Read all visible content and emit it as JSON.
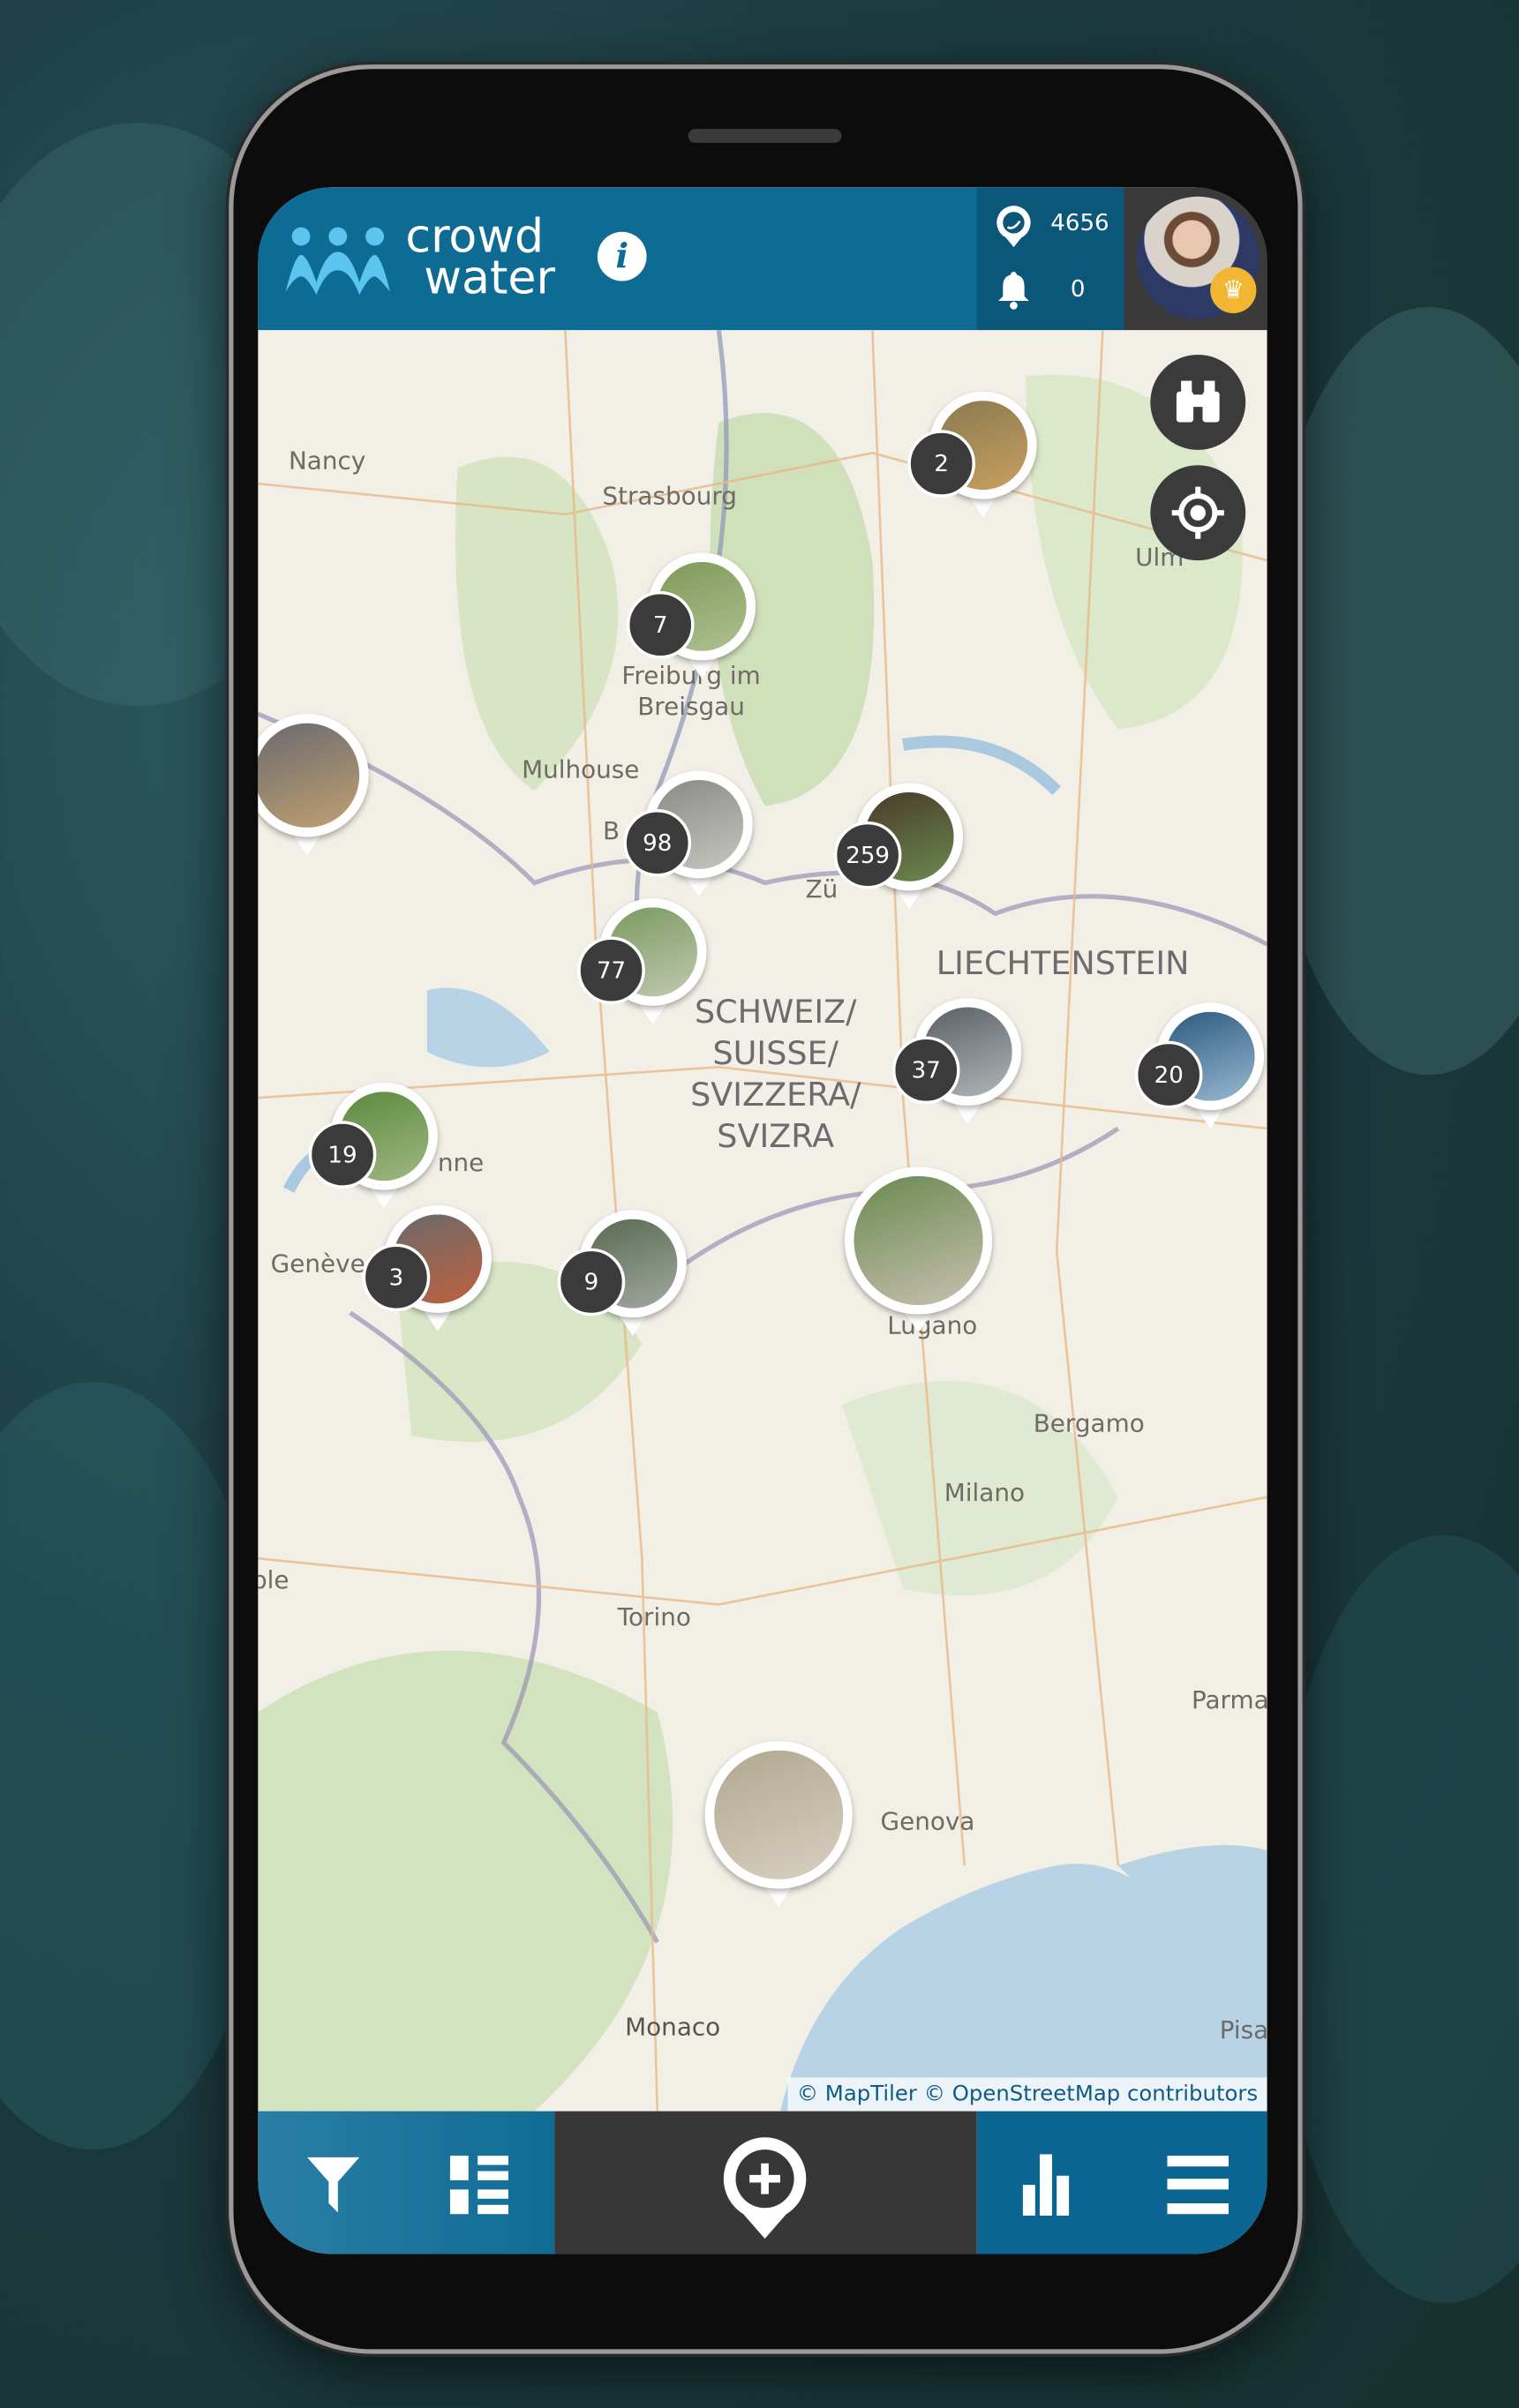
{
  "app": {
    "logo_line1": "crowd",
    "logo_line2": "water",
    "brand_color": "#0e6b93",
    "brand_dark": "#0a5779",
    "crown_color": "#f2b632"
  },
  "header": {
    "points": "4656",
    "notifications": "0",
    "icons": [
      "info-icon",
      "location-pin-icon",
      "bell-icon",
      "crown-icon"
    ]
  },
  "map": {
    "labels": {
      "nancy": "Nancy",
      "strasbourg": "Strasbourg",
      "ulm": "Ulm",
      "freiburg1": "Freiburg im",
      "freiburg2": "Breisgau",
      "mulhouse": "Mulhouse",
      "basel": "B",
      "zurich": "Zü",
      "liechtenstein": "LIECHTENSTEIN",
      "ch1": "SCHWEIZ/",
      "ch2": "SUISSE/",
      "ch3": "SVIZZERA/",
      "ch4": "SVIZRA",
      "lausanne": "nne",
      "geneve": "Genève",
      "lugano": "Lugano",
      "bergamo": "Bergamo",
      "milano": "Milano",
      "torino": "Torino",
      "ble": "ble",
      "parma": "Parma",
      "genova": "Genova",
      "monaco": "Monaco",
      "pisa": "Pisa"
    },
    "clusters": [
      "2",
      "7",
      "",
      "98",
      "259",
      "77",
      "37",
      "20",
      "19",
      "3",
      "9",
      "",
      ""
    ],
    "attribution": "© MapTiler © OpenStreetMap contributors"
  },
  "toolbar": {
    "icons": [
      "filter-icon",
      "list-icon",
      "add-location-icon",
      "stats-icon",
      "menu-icon"
    ]
  }
}
